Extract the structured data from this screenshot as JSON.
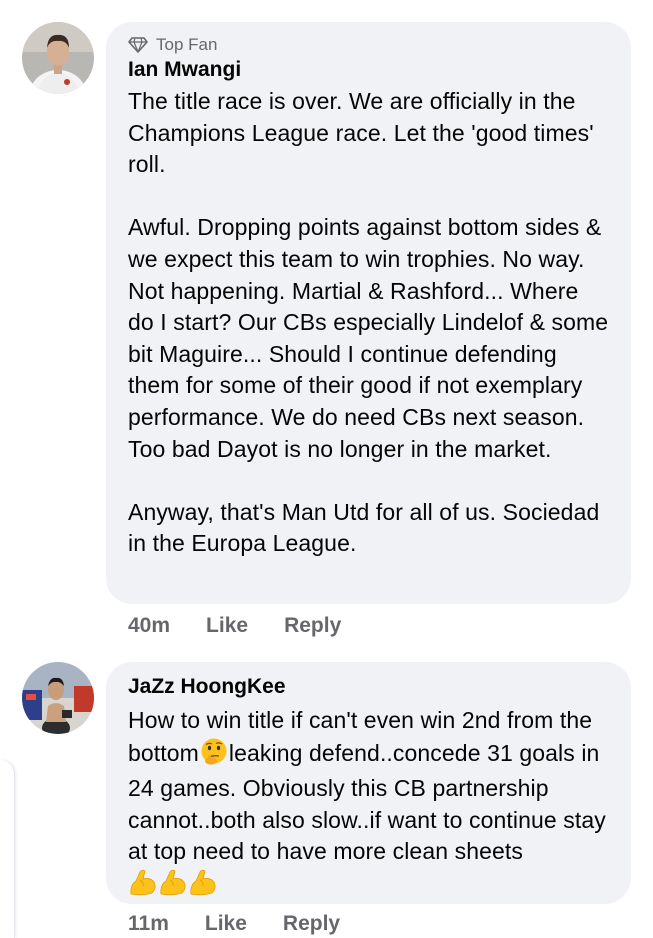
{
  "comments": [
    {
      "badge": "Top Fan",
      "author": "Ian Mwangi",
      "paragraphs": [
        "The title race is over. We are officially in the Champions League race. Let the 'good times' roll.",
        "Awful. Dropping points against bottom sides & we expect this team to win trophies. No way. Not happening. Martial & Rashford... Where do I start? Our CBs especially Lindelof & some bit Maguire... Should I continue defending them for some of their good if not exemplary performance. We do need CBs next season. Too bad Dayot is no longer in the market.",
        "Anyway, that's Man Utd for all of us. Sociedad in the Europa League."
      ],
      "time": "40m",
      "like_label": "Like",
      "reply_label": "Reply"
    },
    {
      "author": "JaZz HoongKee",
      "text_part1": "How to win title if can't even win 2nd from the bottom",
      "text_part2": "leaking defend..concede 31 goals in 24 games. Obviously this CB partnership cannot..both also slow..if want to continue stay at top need to have more clean sheets",
      "emoji_1": "face-with-hand-over-mouth-emoji",
      "emoji_2": "flexed-biceps-emoji",
      "time": "11m",
      "like_label": "Like",
      "reply_label": "Reply"
    }
  ],
  "colors": {
    "bubble": "#f0f2f5",
    "meta_text": "#65676b",
    "text": "#050505"
  }
}
